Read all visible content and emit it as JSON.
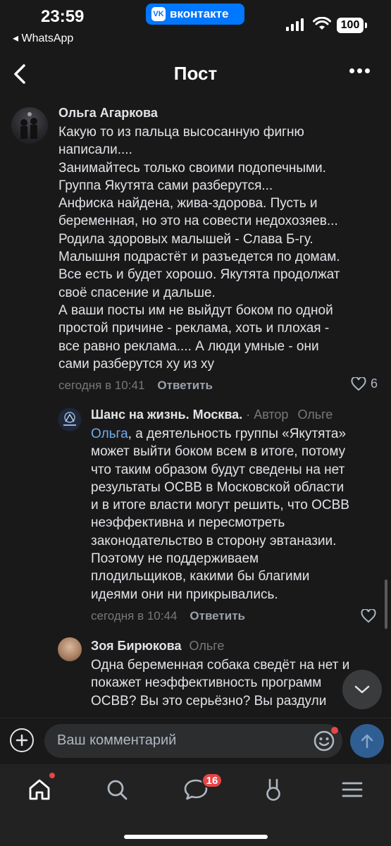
{
  "status_bar": {
    "time": "23:59",
    "back_app": "◂ WhatsApp",
    "vk_label": "вконтакте",
    "vk_logo": "VK",
    "battery": "100"
  },
  "nav": {
    "title": "Пост"
  },
  "comments": [
    {
      "author": "Ольга Агаркова",
      "text": "Какую то из пальца высосанную фигню\nнаписали....\nЗанимайтесь только своими подопечными.\nГруппа Якутята сами разберутся...\nАнфиска найдена, жива-здорова. Пусть и\nбеременная, но это на совести недохозяев...\nРодила здоровых малышей - Слава Б-гу.\nМалышня подрастёт и разъедется по домам.\nВсе есть и будет хорошо. Якутята продолжат\nсвоё спасение и дальше.\nА ваши посты им не выйдут боком по одной\nпростой причине - реклама, хоть и плохая -\nвсе равно реклама.... А люди умные - они\nсами разберутся ху из ху",
      "time": "сегодня в 10:41",
      "reply": "Ответить",
      "likes": "6"
    },
    {
      "author": "Шанс на жизнь. Москва.",
      "author_role": " · Автор",
      "reply_to": "Ольге",
      "mention": "Ольга",
      "text": ", а деятельность группы «Якутята»\nможет выйти  боком всем в итоге, потому\nчто таким образом будут сведены  на нет\nрезультаты ОСВВ в Московской области\nи в итоге власти могут решить, что ОСВВ\nнеэффективна и пересмотреть\nзаконодательство в сторону эвтаназии.\nПоэтому не поддерживаем\nплодильщиков, какими бы благими\nидеями они ни прикрывались.",
      "time": "сегодня в 10:44",
      "reply": "Ответить",
      "likes": ""
    },
    {
      "author": "Зоя Бирюкова",
      "reply_to": "Ольге",
      "text": "Одна беременная собака сведёт на нет и\nпокажет неэффективность программ\nОСВВ? Вы это серьёзно? Вы раздули"
    }
  ],
  "composer": {
    "placeholder": "Ваш комментарий"
  },
  "tabbar": {
    "messages_badge": "16",
    "items": [
      "home-icon",
      "search-icon",
      "messages-icon",
      "services-icon",
      "menu-icon"
    ]
  },
  "colors": {
    "background": "#19191a",
    "link": "#71aaeb",
    "accent": "#0077ff",
    "badge": "#e64646"
  }
}
